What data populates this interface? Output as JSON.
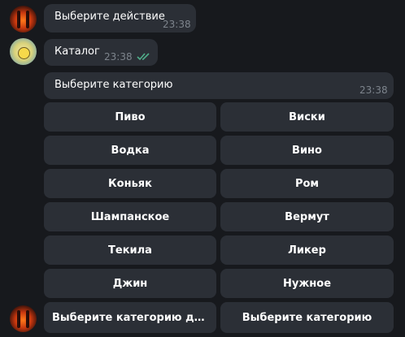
{
  "messages": [
    {
      "text": "Выберите действие",
      "time": "23:38"
    },
    {
      "text": "Каталог",
      "time": "23:38"
    },
    {
      "text": "Выберите категорию",
      "time": "23:38"
    }
  ],
  "keyboard": [
    "Пиво",
    "Виски",
    "Водка",
    "Вино",
    "Коньяк",
    "Ром",
    "Шампанское",
    "Вермут",
    "Текила",
    "Ликер",
    "Джин",
    "Нужное"
  ],
  "reply_keyboard": [
    "Выберите категорию для т...",
    "Выберите категорию"
  ],
  "colors": {
    "background": "#17191d",
    "bubble": "#2b2f36",
    "read_check": "#4fae8a",
    "time": "#7d848c"
  },
  "icons": {
    "read_receipt": "double-check-icon"
  }
}
